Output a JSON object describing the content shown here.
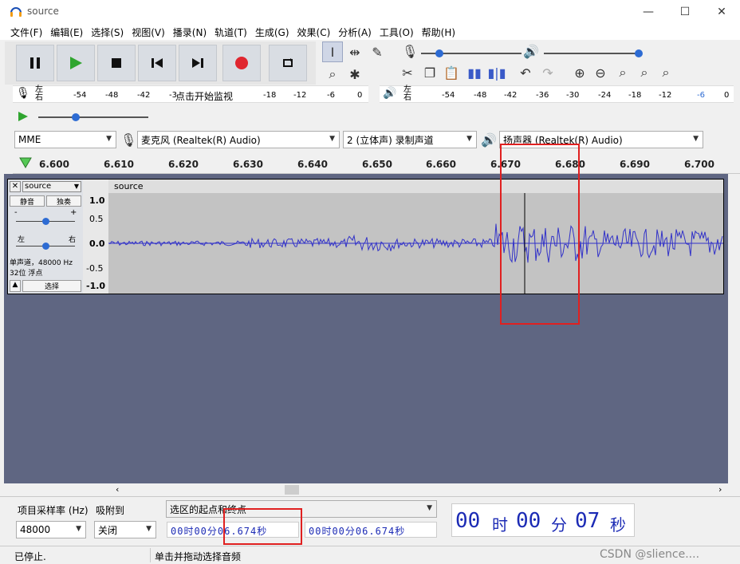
{
  "window": {
    "title": "source",
    "minimize": "—",
    "maximize": "☐",
    "close": "✕"
  },
  "menu": [
    "文件(F)",
    "编辑(E)",
    "选择(S)",
    "视图(V)",
    "播录(N)",
    "轨道(T)",
    "生成(G)",
    "效果(C)",
    "分析(A)",
    "工具(O)",
    "帮助(H)"
  ],
  "meters": {
    "rec_lr": "左\n右",
    "rec_ticks": [
      "-54",
      "-48",
      "-42",
      "-3",
      "点击开始监视",
      "-18",
      "-12",
      "-6",
      "0"
    ],
    "play_ticks": [
      "-54",
      "-48",
      "-42",
      "-36",
      "-30",
      "-24",
      "-18",
      "-12",
      "-6",
      "0"
    ]
  },
  "devices": {
    "host": "MME",
    "mic": "麦克风 (Realtek(R) Audio)",
    "channels": "2 (立体声) 录制声道",
    "speaker": "扬声器 (Realtek(R) Audio)"
  },
  "ruler": {
    "ticks": [
      "6.600",
      "6.610",
      "6.620",
      "6.630",
      "6.640",
      "6.650",
      "6.660",
      "6.670",
      "6.680",
      "6.690",
      "6.700"
    ]
  },
  "track": {
    "name": "source",
    "clip_name": "source",
    "mute": "静音",
    "solo": "独奏",
    "gain_minus": "-",
    "gain_plus": "+",
    "pan_left": "左",
    "pan_right": "右",
    "info1": "单声道，48000 Hz",
    "info2": "32位 浮点",
    "select": "选择",
    "vticks": [
      "1.0",
      "0.5",
      "0.0",
      "-0.5",
      "-1.0"
    ]
  },
  "bottom": {
    "rate_label": "项目采样率 (Hz)",
    "snap_label": "吸附到",
    "rate": "48000",
    "snap": "关闭",
    "sel_label": "选区的起点和终点",
    "sel_start": "00时00分06.674秒",
    "sel_end": "00时00分06.674秒",
    "big_time": {
      "h": "00",
      "h_unit": "时",
      "m": "00",
      "m_unit": "分",
      "s": "07",
      "s_unit": "秒"
    }
  },
  "status": {
    "left": "已停止.",
    "hint": "单击并拖动选择音频",
    "watermark": "CSDN @slience...."
  },
  "colors": {
    "wave": "#3232c8",
    "track_bg": "#5f6682",
    "highlight": "#e02020"
  }
}
